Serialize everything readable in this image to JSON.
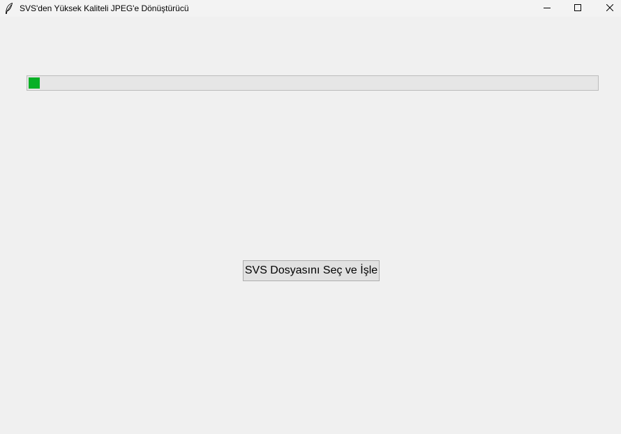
{
  "window": {
    "title": "SVS'den Yüksek Kaliteli JPEG'e Dönüştürücü",
    "icon": "feather-icon",
    "controls": {
      "minimize_icon": "minimize-icon",
      "maximize_icon": "maximize-icon",
      "close_icon": "close-icon"
    }
  },
  "progress": {
    "value_fraction": 0.02,
    "fill_color": "#06b025"
  },
  "main": {
    "button_label": "SVS Dosyasını Seç ve İşle"
  }
}
